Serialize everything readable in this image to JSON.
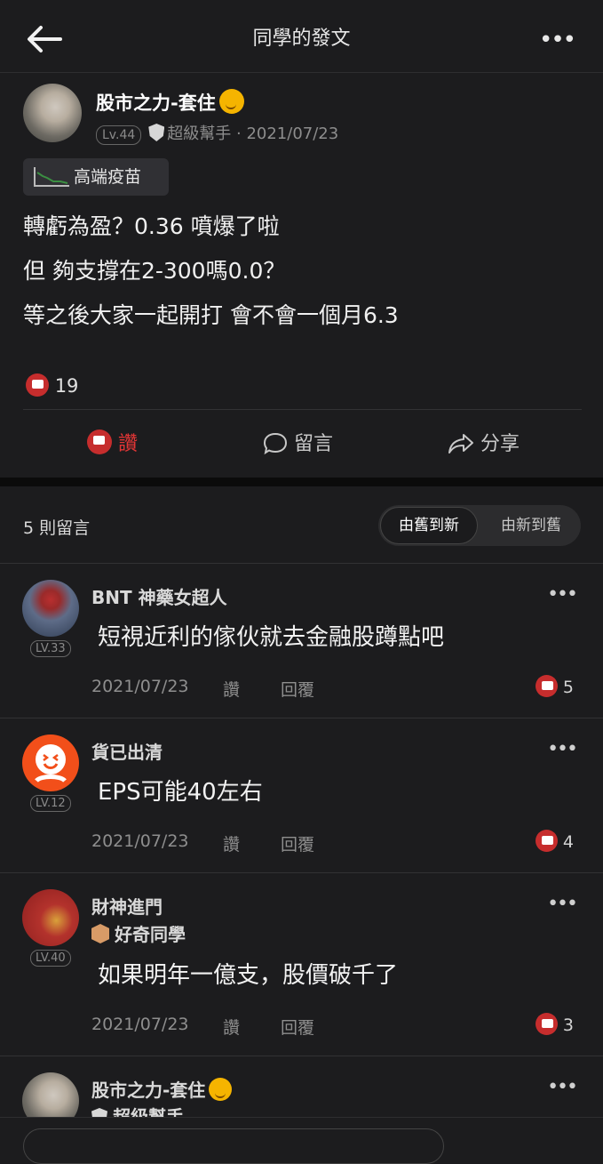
{
  "header": {
    "title": "同學的發文"
  },
  "post": {
    "author": "股市之力-套住",
    "level": "Lv.44",
    "badge": "超級幫手",
    "date": "· 2021/07/23",
    "tag": "高端疫苗",
    "lines": [
      "轉虧為盈？0.36 噴爆了啦",
      "但 夠支撐在2-300嗎0.0？",
      "等之後大家一起開打 會不會一個月6.3"
    ],
    "likes": "19",
    "actions": {
      "like": "讚",
      "comment": "留言",
      "share": "分享"
    }
  },
  "comments_header": {
    "count": "5 則留言",
    "sort_old": "由舊到新",
    "sort_new": "由新到舊"
  },
  "comments": [
    {
      "name": "BNT 神藥女超人",
      "level": "LV.33",
      "text": "短視近利的傢伙就去金融股蹲點吧",
      "date": "2021/07/23",
      "like": "讚",
      "reply": "回覆",
      "likes": "5"
    },
    {
      "name": "貨已出清",
      "level": "LV.12",
      "text": "EPS可能40左右",
      "date": "2021/07/23",
      "like": "讚",
      "reply": "回覆",
      "likes": "4"
    },
    {
      "name": "財神進門",
      "badge": "好奇同學",
      "level": "LV.40",
      "text": "如果明年一億支，股價破千了",
      "date": "2021/07/23",
      "like": "讚",
      "reply": "回覆",
      "likes": "3"
    },
    {
      "name": "股市之力-套住",
      "badge": "超級幫手"
    }
  ],
  "colors": {
    "accent": "#c62d2d",
    "background": "#1c1c1e"
  }
}
